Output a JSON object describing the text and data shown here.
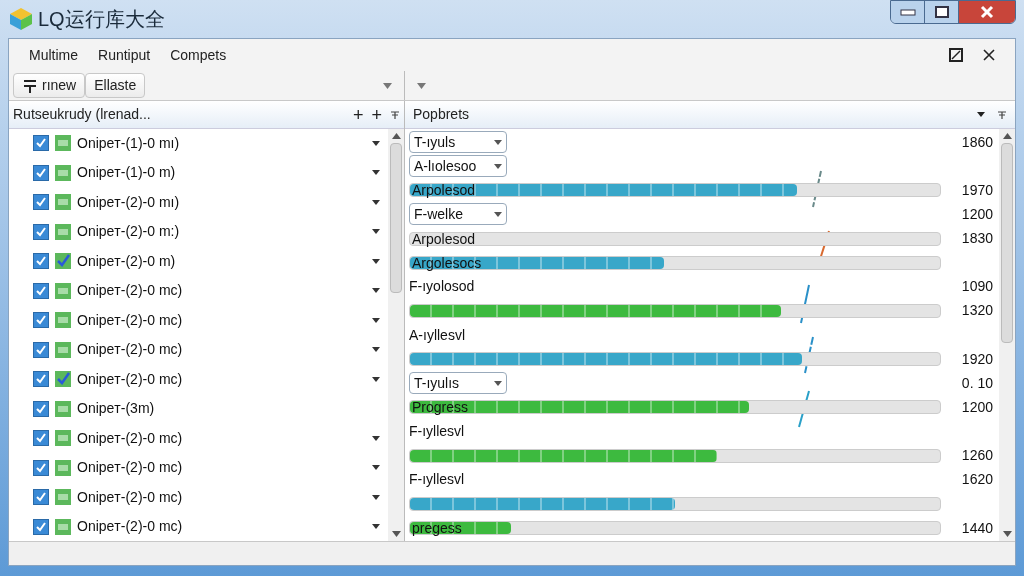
{
  "window": {
    "title": "LQ运行库大全"
  },
  "menu": [
    "Multime",
    "Runtiput",
    "Compets"
  ],
  "toolbar": {
    "buttons": [
      "rınew",
      "Ellaste"
    ]
  },
  "left_pane": {
    "title": "Rutseukrudy (lrenad...",
    "actions": [
      "+",
      "+"
    ],
    "items": [
      {
        "label": "Onipeт-(1)-0 mı)",
        "checked": true,
        "kind": "grid",
        "caret": true
      },
      {
        "label": "Onipeт-(1)-0 m)",
        "checked": true,
        "kind": "grid",
        "caret": true
      },
      {
        "label": "Onipeт-(2)-0 mı)",
        "checked": true,
        "kind": "grid",
        "caret": true
      },
      {
        "label": "Onipeт-(2)-0 m:)",
        "checked": true,
        "kind": "grid",
        "caret": true
      },
      {
        "label": "Onipeт-(2)-0 m)",
        "checked": true,
        "kind": "check",
        "caret": true
      },
      {
        "label": "Onipeт-(2)-0 mc)",
        "checked": true,
        "kind": "grid",
        "caret": true
      },
      {
        "label": "Onipeт-(2)-0 mc)",
        "checked": true,
        "kind": "grid",
        "caret": true
      },
      {
        "label": "Onipeт-(2)-0 mc)",
        "checked": true,
        "kind": "grid",
        "caret": true
      },
      {
        "label": "Onipeт-(2)-0 mc)",
        "checked": true,
        "kind": "check",
        "caret": true
      },
      {
        "label": "Onipeт-(3m)",
        "checked": true,
        "kind": "grid",
        "caret": false
      },
      {
        "label": "Onipeт-(2)-0 mc)",
        "checked": true,
        "kind": "grid",
        "caret": true
      },
      {
        "label": "Onipeт-(2)-0 mc)",
        "checked": true,
        "kind": "grid",
        "caret": true
      },
      {
        "label": "Onipeт-(2)-0 mc)",
        "checked": true,
        "kind": "grid",
        "caret": true
      },
      {
        "label": "Onipeт-(2)-0 mc)",
        "checked": true,
        "kind": "grid",
        "caret": true
      }
    ]
  },
  "right_pane": {
    "title": "Popbrets",
    "rows": [
      {
        "kind": "dropdown",
        "label": "T-ıyuls",
        "value": "1860"
      },
      {
        "kind": "dropdown",
        "label": "A-lıolesoo"
      },
      {
        "kind": "bar",
        "label": "Arpolesod",
        "level": 0.73,
        "color": "#38a7c9",
        "value": "1970"
      },
      {
        "kind": "dropdown",
        "label": "F-welke",
        "value": "1200"
      },
      {
        "kind": "bar",
        "label": "Arpolesod",
        "value": "1830"
      },
      {
        "kind": "bar",
        "label": "Argolesocs",
        "level": 0.48,
        "color": "#38a7c9"
      },
      {
        "kind": "label",
        "label": "F-ıyolosod",
        "value": "1090"
      },
      {
        "kind": "bar",
        "level": 0.7,
        "color": "#3dba3f",
        "value": "1320"
      },
      {
        "kind": "label",
        "label": "A-ıyllesvl"
      },
      {
        "kind": "bar",
        "level": 0.74,
        "color": "#38a7c9",
        "value": "1920"
      },
      {
        "kind": "dropdown",
        "label": "T-ıyulıs",
        "value": "0. 10"
      },
      {
        "kind": "bar",
        "label": "Progress",
        "level": 0.64,
        "color": "#3dba3f",
        "value": "1200"
      },
      {
        "kind": "label",
        "label": "F-ıyllesvl"
      },
      {
        "kind": "bar",
        "level": 0.58,
        "color": "#3dba3f",
        "value": "1260"
      },
      {
        "kind": "label",
        "label": "F-ıyllesvl",
        "value": "1620"
      },
      {
        "kind": "bar",
        "level": 0.5,
        "color": "#38a7c9"
      },
      {
        "kind": "bar",
        "label": "pregess",
        "level": 0.19,
        "color": "#3dba3f",
        "value": "1440"
      }
    ]
  }
}
